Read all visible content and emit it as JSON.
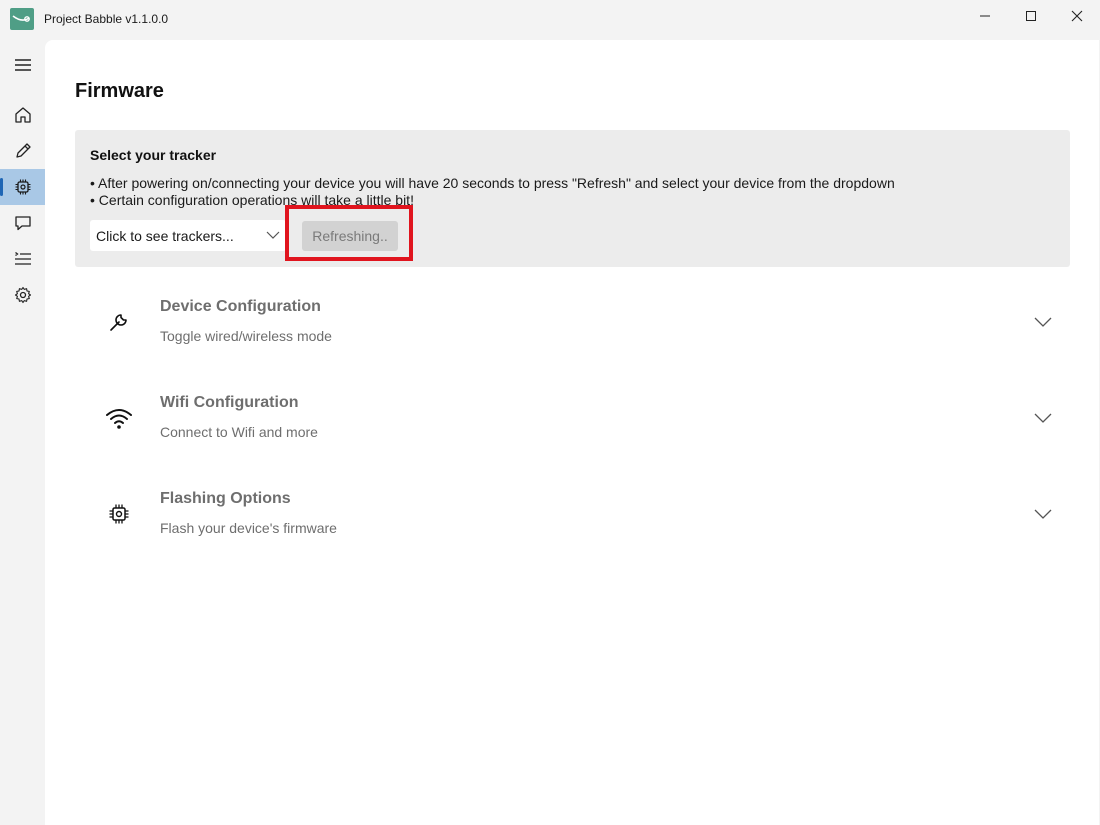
{
  "window": {
    "title": "Project Babble v1.1.0.0"
  },
  "sidebar": {
    "items": [
      {
        "name": "menu",
        "icon": "hamburger-menu-icon"
      },
      {
        "name": "home",
        "icon": "home-icon"
      },
      {
        "name": "edit",
        "icon": "pencil-icon"
      },
      {
        "name": "firmware",
        "icon": "chip-icon",
        "active": true
      },
      {
        "name": "chat",
        "icon": "chat-bubble-icon"
      },
      {
        "name": "list",
        "icon": "list-icon"
      },
      {
        "name": "settings",
        "icon": "gear-icon"
      }
    ]
  },
  "page": {
    "title": "Firmware"
  },
  "tracker": {
    "heading": "Select your tracker",
    "bullets": [
      "• After powering on/connecting your device you will have 20 seconds to press \"Refresh\" and select your device from the dropdown",
      "• Certain configuration operations will take a little bit!"
    ],
    "dropdown_value": "Click to see trackers...",
    "refresh_label": "Refreshing.."
  },
  "sections": [
    {
      "title": "Device Configuration",
      "subtitle": "Toggle wired/wireless mode",
      "icon": "wrench-icon"
    },
    {
      "title": "Wifi Configuration",
      "subtitle": "Connect to Wifi and more",
      "icon": "wifi-icon"
    },
    {
      "title": "Flashing Options",
      "subtitle": "Flash your device's firmware",
      "icon": "chip-icon"
    }
  ],
  "colors": {
    "accent": "#1f66b5",
    "active_nav_bg": "#a9c8e6",
    "highlight": "#e0141e",
    "logo": "#4f9e86"
  }
}
